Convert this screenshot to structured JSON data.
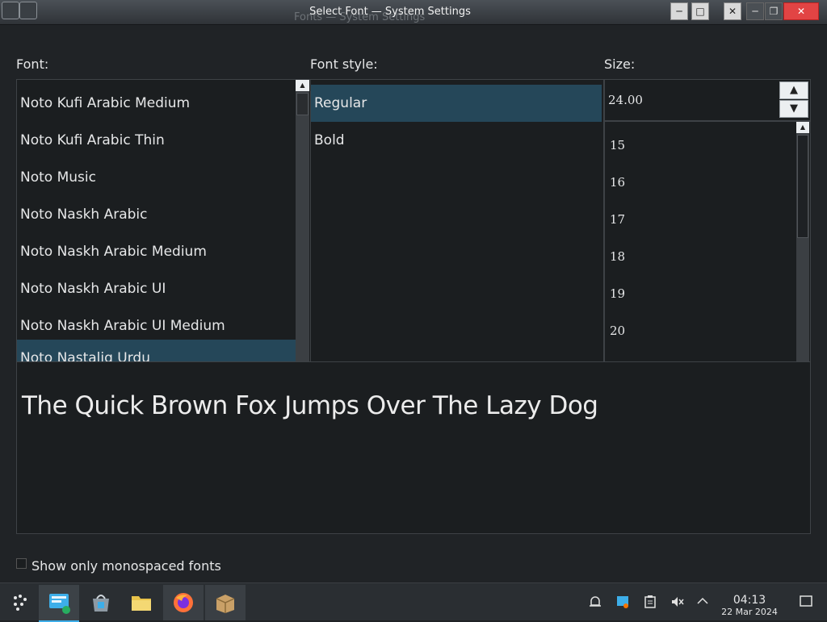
{
  "window": {
    "title": "Select Font — System Settings",
    "ghost_title": "Fonts — System Settings"
  },
  "labels": {
    "font": "Font:",
    "style": "Font style:",
    "size": "Size:"
  },
  "font_list": [
    "Noto Kufi Arabic Medium",
    "Noto Kufi Arabic Thin",
    "Noto Music",
    "Noto Naskh Arabic",
    "Noto Naskh Arabic Medium",
    "Noto Naskh Arabic UI",
    "Noto Naskh Arabic UI Medium",
    "Noto Nastaliq Urdu"
  ],
  "style_list": [
    "Regular",
    "Bold"
  ],
  "size": {
    "value": "24.00",
    "list": [
      "15",
      "16",
      "17",
      "18",
      "19",
      "20"
    ]
  },
  "preview_text": "The Quick Brown Fox Jumps Over The Lazy Dog",
  "checkbox": {
    "label": "Show only monospaced fonts",
    "checked": false
  },
  "clock": {
    "time": "04:13",
    "date": "22 Mar 2024"
  },
  "icons": {
    "up": "▲",
    "down": "▼",
    "min": "─",
    "max": "□",
    "close": "✕"
  }
}
